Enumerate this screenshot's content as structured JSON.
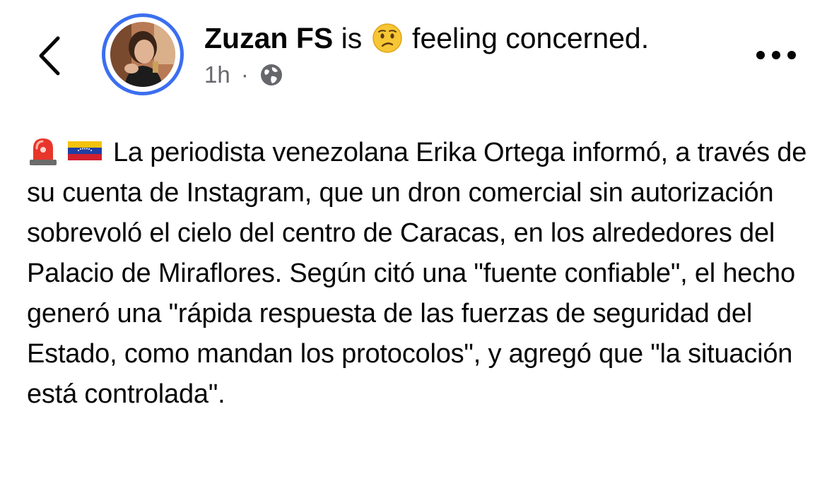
{
  "header": {
    "author_name": "Zuzan FS",
    "status_prefix": "is",
    "status_text": "feeling concerned.",
    "status_emoji": "worried-face-icon",
    "timestamp": "1h",
    "separator": "·",
    "audience_icon": "globe-icon"
  },
  "post": {
    "emojis": [
      "police-light-icon",
      "venezuela-flag-icon"
    ],
    "text": "La periodista venezolana Erika Ortega informó, a través de su cuenta de Instagram, que un dron comercial sin autorización sobrevoló el cielo del centro de Caracas, en los alrededores del Palacio de Miraflores. Según citó una \"fuente confiable\", el hecho generó una \"rápida respuesta de las fuerzas de seguridad del Estado, como mandan los protocolos\", y agregó que \"la situación está controlada\"."
  },
  "colors": {
    "avatar_ring": "#3b6ff0",
    "meta_text": "#65676b",
    "text": "#050505"
  }
}
